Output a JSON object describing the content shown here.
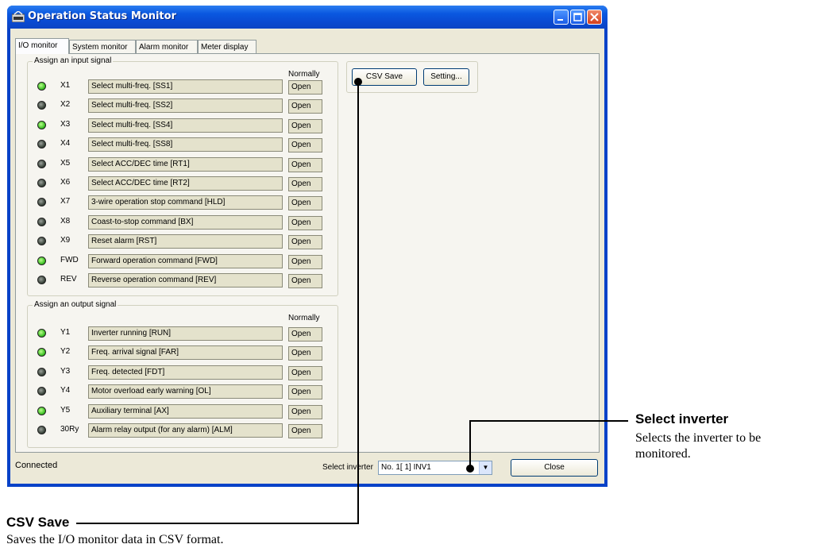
{
  "window": {
    "title": "Operation Status Monitor",
    "app_icon": "inverter-app-icon"
  },
  "tabs": [
    {
      "label": "I/O monitor",
      "active": true
    },
    {
      "label": "System monitor",
      "active": false
    },
    {
      "label": "Alarm monitor",
      "active": false
    },
    {
      "label": "Meter display",
      "active": false
    }
  ],
  "input_group": {
    "title": "Assign an input signal",
    "normally_header": "Normally",
    "rows": [
      {
        "signal": "X1",
        "description": "Select multi-freq. [SS1]",
        "state": "Open",
        "led": "on"
      },
      {
        "signal": "X2",
        "description": "Select multi-freq. [SS2]",
        "state": "Open",
        "led": "off"
      },
      {
        "signal": "X3",
        "description": "Select multi-freq. [SS4]",
        "state": "Open",
        "led": "on"
      },
      {
        "signal": "X4",
        "description": "Select multi-freq. [SS8]",
        "state": "Open",
        "led": "off"
      },
      {
        "signal": "X5",
        "description": "Select ACC/DEC time [RT1]",
        "state": "Open",
        "led": "off"
      },
      {
        "signal": "X6",
        "description": "Select ACC/DEC time [RT2]",
        "state": "Open",
        "led": "off"
      },
      {
        "signal": "X7",
        "description": "3-wire operation stop command [HLD]",
        "state": "Open",
        "led": "off"
      },
      {
        "signal": "X8",
        "description": "Coast-to-stop command [BX]",
        "state": "Open",
        "led": "off"
      },
      {
        "signal": "X9",
        "description": "Reset alarm [RST]",
        "state": "Open",
        "led": "off"
      },
      {
        "signal": "FWD",
        "description": "Forward operation command [FWD]",
        "state": "Open",
        "led": "on"
      },
      {
        "signal": "REV",
        "description": "Reverse operation command [REV]",
        "state": "Open",
        "led": "off"
      }
    ]
  },
  "output_group": {
    "title": "Assign an output signal",
    "normally_header": "Normally",
    "rows": [
      {
        "signal": "Y1",
        "description": "Inverter running [RUN]",
        "state": "Open",
        "led": "on"
      },
      {
        "signal": "Y2",
        "description": "Freq. arrival signal [FAR]",
        "state": "Open",
        "led": "on"
      },
      {
        "signal": "Y3",
        "description": "Freq. detected [FDT]",
        "state": "Open",
        "led": "off"
      },
      {
        "signal": "Y4",
        "description": "Motor overload early warning [OL]",
        "state": "Open",
        "led": "off"
      },
      {
        "signal": "Y5",
        "description": "Auxiliary terminal [AX]",
        "state": "Open",
        "led": "on"
      },
      {
        "signal": "30Ry",
        "description": "Alarm relay output (for any alarm) [ALM]",
        "state": "Open",
        "led": "off"
      }
    ]
  },
  "buttons": {
    "csv_save": "CSV Save",
    "setting": "Setting...",
    "close": "Close"
  },
  "status_bar": {
    "status": "Connected",
    "select_inverter_label": "Select inverter",
    "select_inverter_value": "No. 1[ 1] INV1"
  },
  "annotations": {
    "select_inverter": {
      "title": "Select inverter",
      "description_line1": "Selects the inverter to be",
      "description_line2": "monitored."
    },
    "csv_save": {
      "title": "CSV Save",
      "description": "Saves the I/O monitor data in CSV format."
    }
  },
  "colors": {
    "titlebar": "#0a58e0",
    "led_on": "#2fb81a",
    "led_off": "#2f3a30",
    "client_bg": "#ece9d8"
  }
}
